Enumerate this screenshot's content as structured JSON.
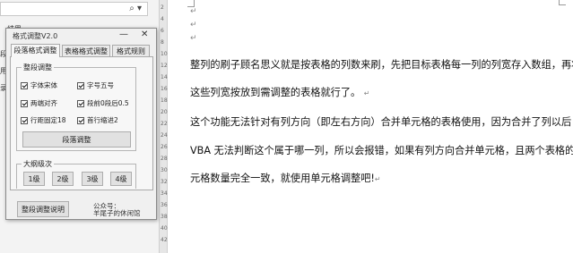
{
  "left_pane": {
    "search_icon": "magnifier-icon",
    "search_caret": "▾",
    "fragments": [
      "结果",
      "段式",
      "用保",
      "录扩"
    ]
  },
  "ruler": {
    "numbers": [
      "2",
      "4",
      "6",
      "8",
      "10",
      "12",
      "14",
      "16",
      "18",
      "20",
      "22",
      "24",
      "26",
      "28",
      "30",
      "32",
      "34",
      "36",
      "38",
      "40",
      "42"
    ]
  },
  "document": {
    "lines": [
      "整列的刷子顾名思义就是按表格的列数来刷，先把目标表格每一列的列宽存入数组，再将",
      "这些列宽按放到需调整的表格就行了。",
      "这个功能无法针对有列方向（即左右方向）合并单元格的表格使用，因为合并了列以后",
      "VBA 无法判断这个属于哪一列，所以会报错，如果有列方向合并单元格，且两个表格的单",
      "元格数量完全一致，就使用单元格调整吧!"
    ],
    "para_mark": "↵"
  },
  "dialog": {
    "title": "格式调整V2.0",
    "minimize": "—",
    "close": "✕",
    "tabs": [
      "段落格式调整",
      "表格格式调整",
      "格式规则"
    ],
    "group_para_title": "整段调整",
    "checkboxes": [
      {
        "label": "字体宋体",
        "checked": true
      },
      {
        "label": "字号五号",
        "checked": true
      },
      {
        "label": "两端对齐",
        "checked": true
      },
      {
        "label": "段前0段后0.5",
        "checked": true
      },
      {
        "label": "行距固定18",
        "checked": true
      },
      {
        "label": "首行缩进2",
        "checked": true
      }
    ],
    "para_adjust_button": "段落调整",
    "group_outline_title": "大纲级次",
    "level_buttons": [
      "1级",
      "2级",
      "3级",
      "4级"
    ],
    "explain_button": "整段调整说明",
    "public_account": [
      "公众号：",
      "羊尾子的休闲馆"
    ]
  }
}
